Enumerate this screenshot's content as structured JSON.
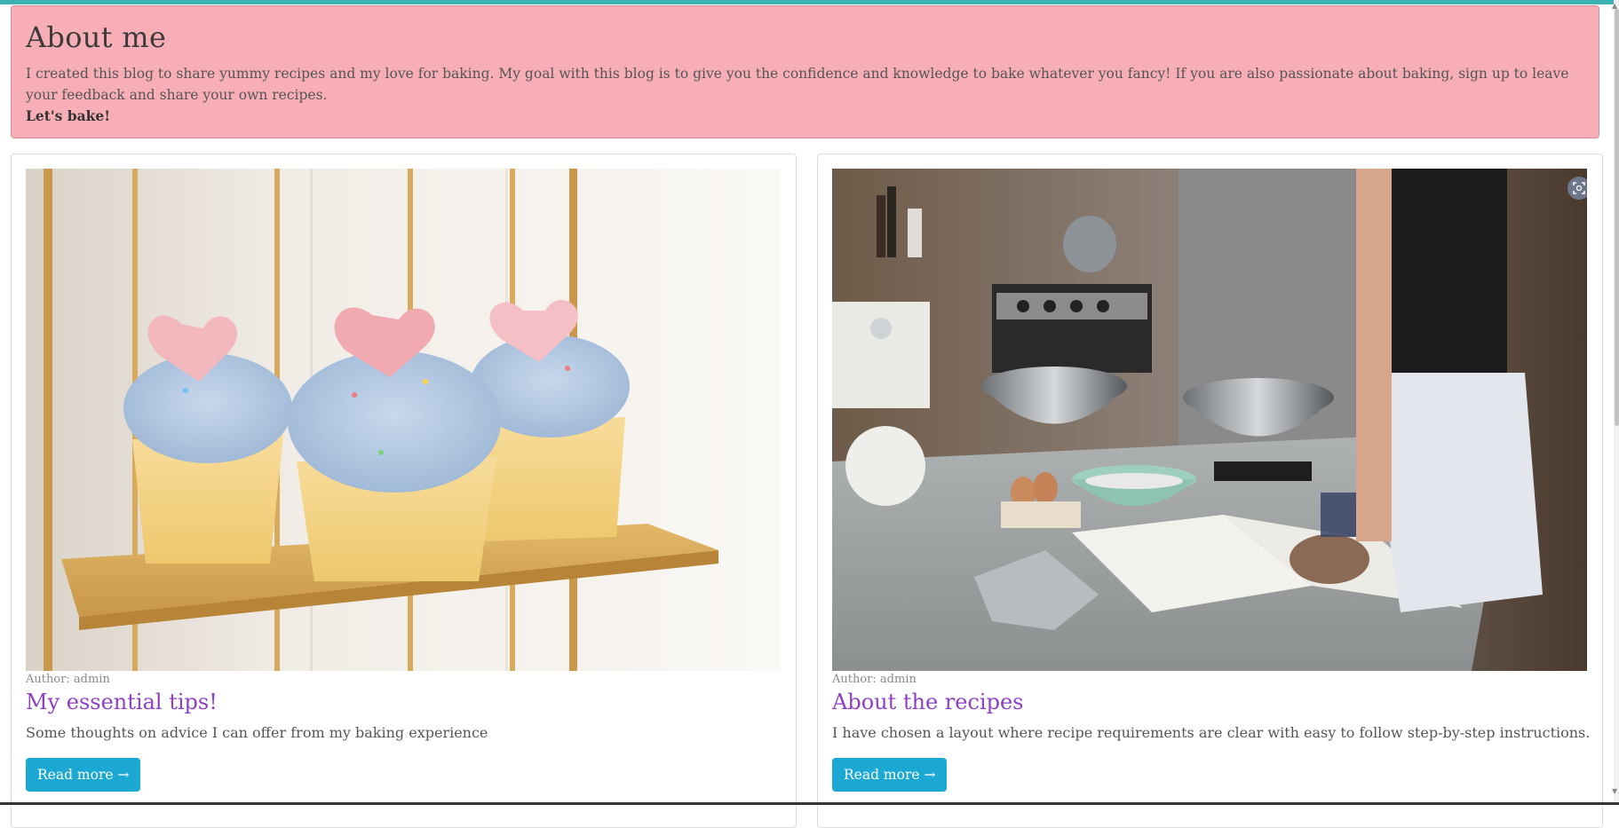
{
  "about": {
    "title": "About me",
    "body": "I created this blog to share yummy recipes and my love for baking. My goal with this blog is to give you the confidence and knowledge to bake whatever you fancy! If you are also passionate about baking, sign up to leave your feedback and share your own recipes.",
    "closing": "Let's bake!"
  },
  "posts": [
    {
      "author": "Author: admin",
      "title": "My essential tips!",
      "excerpt": "Some thoughts on advice I can offer from my baking experience",
      "button": "Read more →",
      "image": "cupcakes-photo"
    },
    {
      "author": "Author: admin",
      "title": "About the recipes",
      "excerpt": "I have chosen a layout where recipe requirements are clear with easy to follow step-by-step instructions.",
      "button": "Read more →",
      "image": "kitchen-baking-photo"
    }
  ],
  "icons": {
    "lens": "visual-search-icon"
  },
  "colors": {
    "about_bg": "#f8aeb6",
    "link": "#8e3fc4",
    "button": "#1ba9d3",
    "top_strip": "#3bb3b5"
  }
}
